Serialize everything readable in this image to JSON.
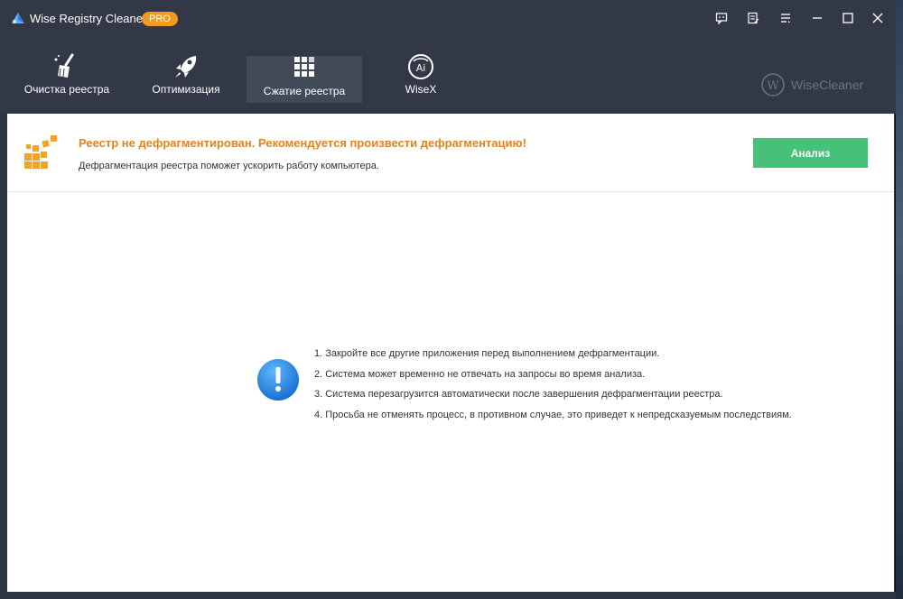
{
  "window": {
    "title": "Wise Registry Cleaner 11",
    "badge": "PRO"
  },
  "title_buttons": [
    "feedback-icon",
    "notes-icon",
    "menu-icon",
    "minimize-icon",
    "maximize-icon",
    "close-icon"
  ],
  "nav": {
    "items": [
      {
        "label": "Очистка реестра",
        "icon": "broom-icon"
      },
      {
        "label": "Оптимизация",
        "icon": "rocket-icon"
      },
      {
        "label": "Сжатие реестра",
        "icon": "grid-icon",
        "active": true
      },
      {
        "label": "WiseX",
        "icon": "ai-icon"
      }
    ],
    "brand": "WiseCleaner"
  },
  "alert": {
    "title": "Реестр не дефрагментирован. Рекомендуется произвести дефрагментацию!",
    "subtitle": "Дефрагментация реестра поможет ускорить работу компьютера.",
    "button": "Анализ"
  },
  "notes": [
    "1. Закройте все другие приложения перед выполнением дефрагментации.",
    "2. Система может временно не отвечать на запросы во время анализа.",
    "3. Система перезагрузится автоматически после завершения дефрагментации реестра.",
    "4. Просьба не отменять процесс, в противном случае, это приведет к непредсказуемым последствиям."
  ],
  "colors": {
    "titlebar": "#323846",
    "accent_orange": "#e5821d",
    "button_green": "#47c17a",
    "badge_orange": "#f29b1e"
  }
}
